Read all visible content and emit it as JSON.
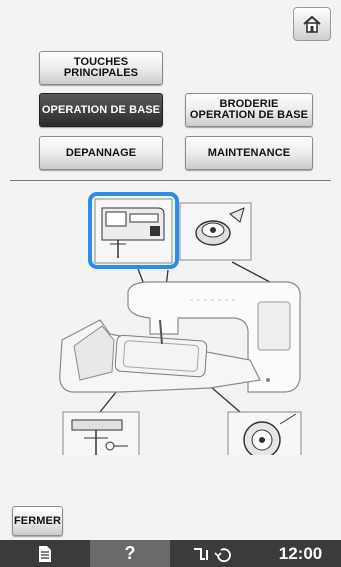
{
  "header": {
    "home_icon": "home-icon"
  },
  "menu": {
    "touches_principales": "TOUCHES\nPRINCIPALES",
    "operation_de_base": "OPERATION DE BASE",
    "broderie_operation_de_base": "BRODERIE\nOPERATION DE BASE",
    "depannage": "DEPANNAGE",
    "maintenance": "MAINTENANCE"
  },
  "diagram": {
    "selected_thumbnail": "thread-guide-thumbnail",
    "machine_panel_label": "☐☐ ☐☐    ☐☐"
  },
  "footer": {
    "close_label": "FERMER"
  },
  "status_bar": {
    "doc_icon": "document-icon",
    "help_icon": "help-icon",
    "sensor_icon": "sensor-icon",
    "clock": "12:00"
  },
  "colors": {
    "selection_ring": "#2a8ee8",
    "status_bar": "#3b3b3b"
  }
}
